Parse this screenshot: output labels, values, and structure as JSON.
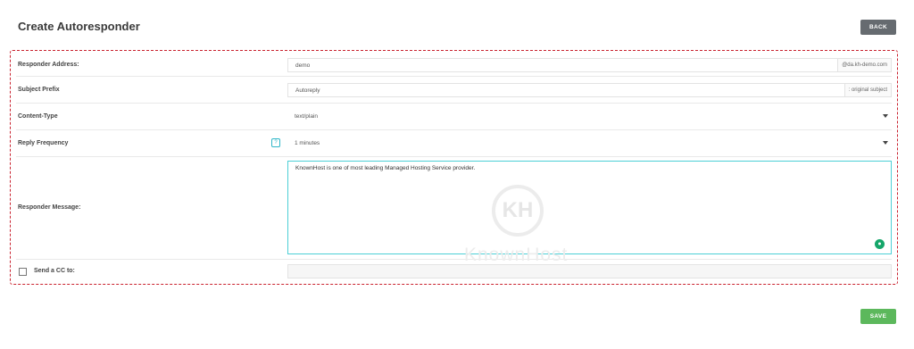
{
  "header": {
    "title": "Create Autoresponder",
    "back_label": "BACK"
  },
  "form": {
    "responder_address": {
      "label": "Responder Address:",
      "value": "demo",
      "suffix": "@da.kh-demo.com"
    },
    "subject_prefix": {
      "label": "Subject Prefix",
      "value": "Autoreply",
      "suffix": ": original subject"
    },
    "content_type": {
      "label": "Content-Type",
      "selected": "text/plain"
    },
    "reply_frequency": {
      "label": "Reply Frequency",
      "selected": "1 minutes",
      "help": "?"
    },
    "responder_message": {
      "label": "Responder Message:",
      "value": "KnownHost is one of most leading Managed Hosting Service provider."
    },
    "send_cc": {
      "label": "Send a CC to:",
      "checked": false,
      "value": ""
    }
  },
  "watermark": {
    "logo_text": "KH",
    "brand_text": "KnownHost"
  },
  "footer": {
    "save_label": "SAVE"
  },
  "colors": {
    "panel_border": "#c9212e",
    "save_button": "#5cb85c",
    "back_button": "#666b70",
    "focus_border": "#4ccfd6"
  },
  "icons": {
    "dropdown": "caret-down-icon",
    "help": "help-icon",
    "grammar": "grammarly-icon",
    "checkbox": "checkbox-icon"
  }
}
